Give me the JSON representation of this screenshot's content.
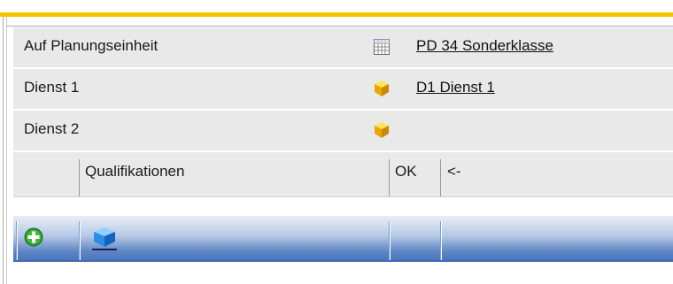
{
  "rows": [
    {
      "label": "Auf Planungseinheit",
      "icon": "grid-icon",
      "value": "PD 34 Sonderklasse"
    },
    {
      "label": "Dienst 1",
      "icon": "gold-cube-icon",
      "value": "D1 Dienst 1"
    },
    {
      "label": "Dienst 2",
      "icon": "gold-cube-icon",
      "value": ""
    }
  ],
  "table": {
    "headers": {
      "qualifikationen": "Qualifikationen",
      "ok": "OK",
      "back": "<-"
    }
  },
  "toolbar": {
    "add_icon": "add-green-icon",
    "cube_icon": "blue-cube-icon"
  },
  "colors": {
    "accent": "#f5c400",
    "row_bg": "#e9e9e9",
    "toolbar_blue": "#4a76bd"
  }
}
